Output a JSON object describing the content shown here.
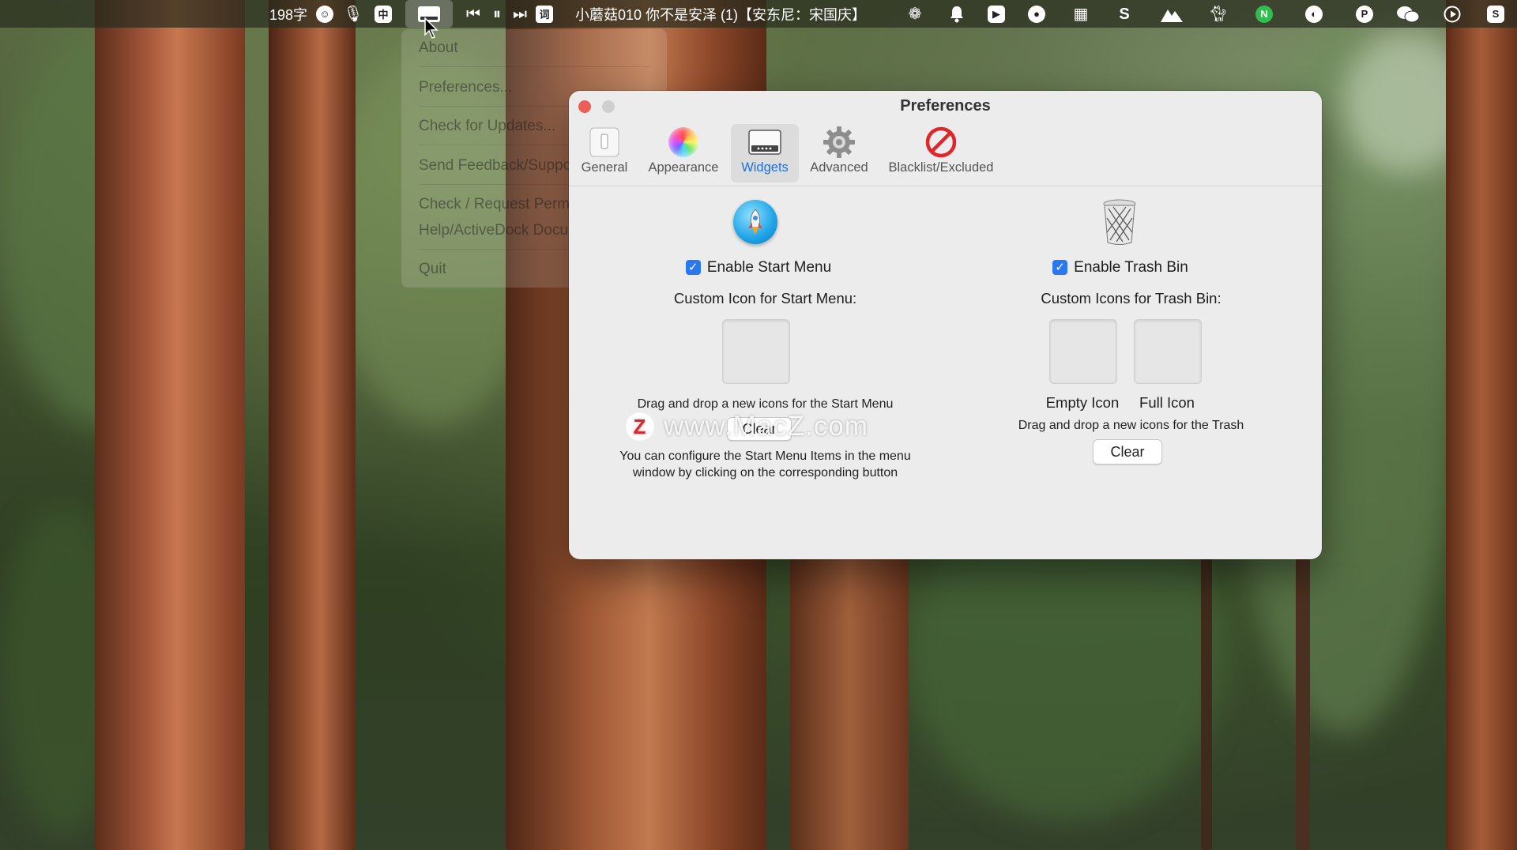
{
  "menubar": {
    "word_count": "198字",
    "now_playing": "小蘑菇010 你不是安泽 (1)【安东尼：宋国庆】",
    "icons": [
      "smiley-icon",
      "microphone-icon",
      "input-method-icon",
      "activedock-icon",
      "previous-track-icon",
      "pause-icon",
      "next-track-icon",
      "lyrics-icon",
      "settings-flower-icon",
      "notification-bell-icon",
      "app-b-icon",
      "app-c-icon",
      "app-grid-icon",
      "app-s-icon",
      "app-mountain-icon",
      "app-cat-icon",
      "app-n-icon",
      "app-a-icon",
      "app-p-icon",
      "wechat-icon",
      "play-icon",
      "app-s2-icon"
    ],
    "n_badge": "N",
    "input_method_label": "中",
    "lyrics_label": "词"
  },
  "app_menu": {
    "items": [
      "About",
      "Preferences...",
      "Check for Updates...",
      "Send Feedback/Support",
      "Check / Request Permissions",
      "Help/ActiveDock Documentation",
      "Quit"
    ]
  },
  "window": {
    "title": "Preferences",
    "tabs": [
      {
        "label": "General",
        "icon": "switch-icon"
      },
      {
        "label": "Appearance",
        "icon": "color-wheel-icon"
      },
      {
        "label": "Widgets",
        "icon": "widgets-icon",
        "selected": true
      },
      {
        "label": "Advanced",
        "icon": "gear-icon"
      },
      {
        "label": "Blacklist/Excluded",
        "icon": "prohibited-icon"
      }
    ],
    "start_menu": {
      "checkbox_label": "Enable Start Menu",
      "checked": true,
      "custom_icon_label": "Custom Icon for Start Menu:",
      "drag_hint": "Drag and drop a new icons for the Start Menu",
      "clear_label": "Clear",
      "config_note_line1": "You can configure the Start Menu Items in the menu",
      "config_note_line2": "window by clicking on the corresponding button"
    },
    "trash": {
      "checkbox_label": "Enable Trash Bin",
      "checked": true,
      "custom_icons_label": "Custom Icons for Trash Bin:",
      "empty_icon_label": "Empty Icon",
      "full_icon_label": "Full Icon",
      "drag_hint": "Drag and drop a new icons for the Trash",
      "clear_label": "Clear"
    }
  },
  "watermark": {
    "logo": "Z",
    "text": "www.MacZ.com"
  },
  "colors": {
    "accent": "#2a78f0",
    "close_red": "#ec5f56",
    "selected_tab_text": "#1f6fe0"
  }
}
